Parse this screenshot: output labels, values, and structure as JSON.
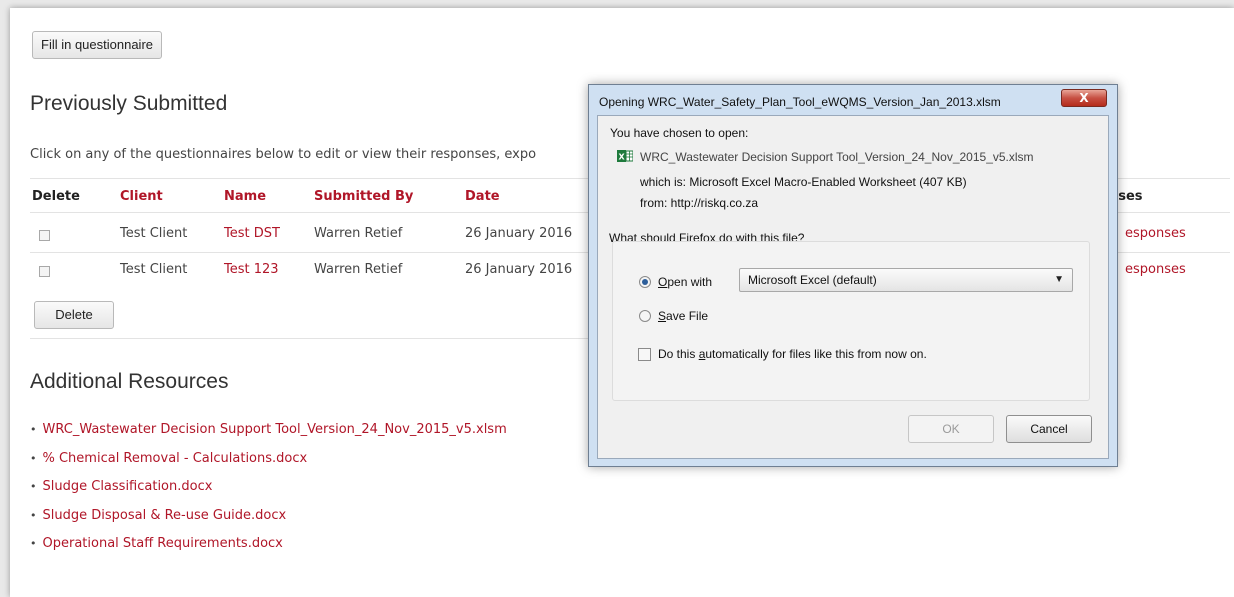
{
  "toolbar": {
    "fill_label": "Fill in questionnaire"
  },
  "submitted": {
    "heading": "Previously Submitted",
    "intro": "Click on any of the questionnaires below to edit or view their responses, expo",
    "columns": {
      "delete": "Delete",
      "client": "Client",
      "name": "Name",
      "submitted_by": "Submitted By",
      "date": "Date",
      "responses": "nses"
    },
    "rows": [
      {
        "client": "Test Client",
        "name": "Test DST",
        "submitted_by": "Warren Retief",
        "date": "26 January 2016",
        "responses": "esponses"
      },
      {
        "client": "Test Client",
        "name": "Test 123",
        "submitted_by": "Warren Retief",
        "date": "26 January 2016",
        "responses": "esponses"
      }
    ],
    "delete_label": "Delete"
  },
  "resources": {
    "heading": "Additional Resources",
    "items": [
      "WRC_Wastewater Decision Support Tool_Version_24_Nov_2015_v5.xlsm",
      "% Chemical Removal - Calculations.docx",
      "Sludge Classification.docx",
      "Sludge Disposal & Re-use Guide.docx",
      "Operational Staff Requirements.docx"
    ]
  },
  "dialog": {
    "title": "Opening WRC_Water_Safety_Plan_Tool_eWQMS_Version_Jan_2013.xlsm",
    "close_label": "X",
    "chosen_text": "You have chosen to open:",
    "file_name": "WRC_Wastewater Decision Support Tool_Version_24_Nov_2015_v5.xlsm",
    "which_is": "which is: Microsoft Excel Macro-Enabled Worksheet (407 KB)",
    "from": "from: http://riskq.co.za",
    "question": "What should Firefox do with this file?",
    "open_with_prefix": "O",
    "open_with_rest": "pen with",
    "open_with_value": "Microsoft Excel (default)",
    "save_prefix": "S",
    "save_rest": "ave File",
    "auto_before": "Do this ",
    "auto_u": "a",
    "auto_after": "utomatically for files like this from now on.",
    "ok_label": "OK",
    "cancel_label": "Cancel",
    "selected_option": "open_with",
    "colors": {
      "accent_red": "#b01628",
      "excel_green": "#1e7a3c"
    }
  }
}
